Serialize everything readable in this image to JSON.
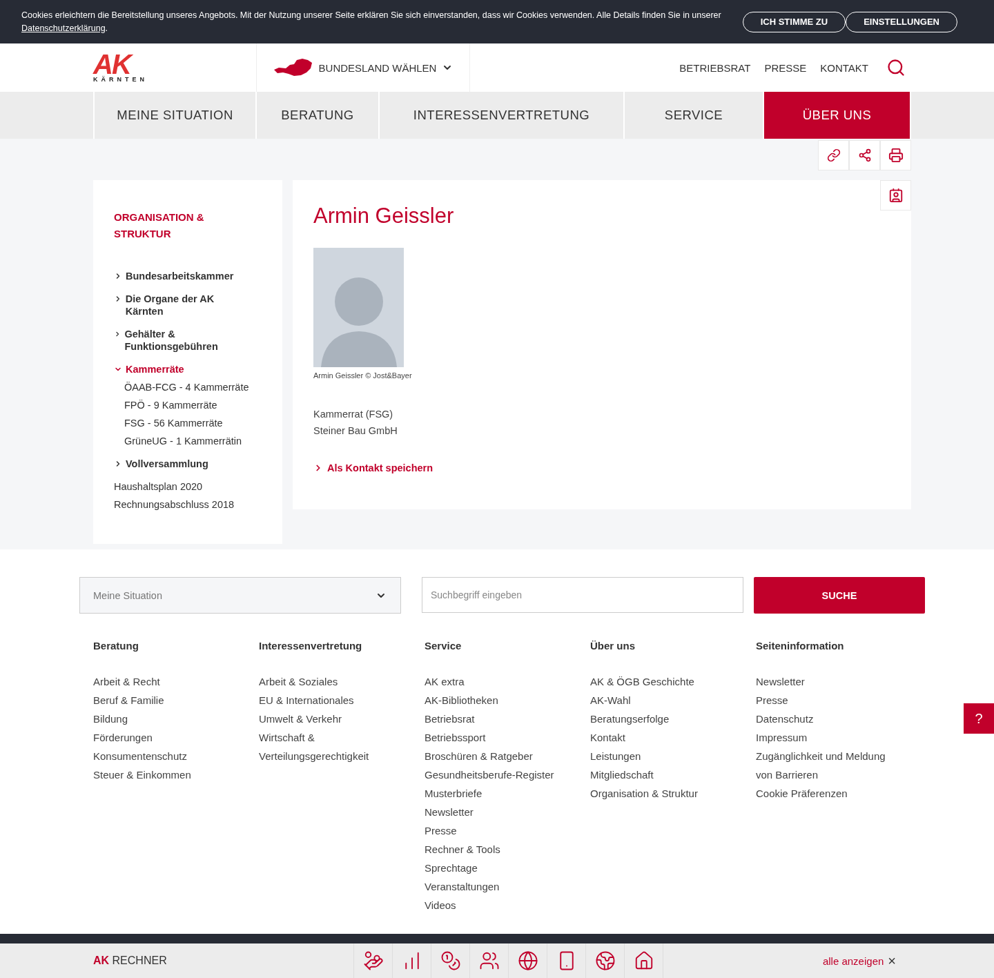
{
  "cookie_banner": {
    "text": "Cookies erleichtern die Bereitstellung unseres Angebots. Mit der Nutzung unserer Seite erklären Sie sich einverstanden, dass wir Cookies verwenden. Alle Details finden Sie in unserer",
    "link": "Datenschutzerklärung",
    "after_link": ".",
    "buttons": [
      "ICH STIMME ZU",
      "EINSTELLUNGEN"
    ]
  },
  "header": {
    "logo_mark": "AK",
    "logo_sub": "KÄRNTEN",
    "region_select": "BUNDESLAND WÄHLEN",
    "links": [
      "BETRIEBSRAT",
      "PRESSE",
      "KONTAKT"
    ]
  },
  "nav": [
    {
      "label": "MEINE SITUATION",
      "selected": false
    },
    {
      "label": "BERATUNG",
      "selected": false
    },
    {
      "label": "INTERESSENVERTRETUNG",
      "selected": false
    },
    {
      "label": "SERVICE",
      "selected": false
    },
    {
      "label": "ÜBER UNS",
      "selected": true
    }
  ],
  "sidebar": {
    "title": "ORGANISATION & STRUKTUR",
    "items": [
      {
        "kind": "group",
        "label": "Bundesarbeitskammer",
        "expanded": false,
        "selected": false
      },
      {
        "kind": "group",
        "label": "Die Organe der AK Kärnten",
        "expanded": false,
        "selected": false
      },
      {
        "kind": "group",
        "label": "Gehälter & Funktionsgebühren",
        "expanded": false,
        "selected": false
      },
      {
        "kind": "group",
        "label": "Kammerräte",
        "expanded": true,
        "selected": true,
        "children": [
          {
            "label": "ÖAAB-FCG - 4 Kammerräte"
          },
          {
            "label": "FPÖ - 9 Kammerräte"
          },
          {
            "label": "FSG - 56 Kammerräte"
          },
          {
            "label": "GrüneUG - 1 Kammerrätin"
          }
        ]
      },
      {
        "kind": "group",
        "label": "Vollversammlung",
        "expanded": false,
        "selected": false
      },
      {
        "kind": "link",
        "label": "Haushaltsplan 2020"
      },
      {
        "kind": "link",
        "label": "Rechnungsabschluss 2018"
      }
    ]
  },
  "person": {
    "name": "Armin Geissler",
    "caption": "Armin Geissler © Jost&Bayer",
    "details": [
      "Kammerrat (FSG)",
      "Steiner Bau GmbH"
    ],
    "contact_link": "Als Kontakt speichern"
  },
  "footer": {
    "situation_select": "Meine Situation",
    "search": {
      "placeholder": "Suchbegriff eingeben"
    },
    "search_button": "SUCHE",
    "columns": [
      {
        "heading": "Beratung",
        "links": [
          "Arbeit & Recht",
          "Beruf & Familie",
          "Bildung",
          "Förderungen",
          "Konsumentenschutz",
          "Steuer & Einkommen"
        ]
      },
      {
        "heading": "Interessenvertretung",
        "links": [
          "Arbeit & Soziales",
          "EU & Internationales",
          "Umwelt & Verkehr",
          "Wirtschaft & Verteilungsgerechtigkeit"
        ]
      },
      {
        "heading": "Service",
        "links": [
          "AK extra",
          "AK-Bibliotheken",
          "Betriebsrat",
          "Betriebssport",
          "Broschüren & Ratgeber",
          "Gesundheitsberufe-Register",
          "Musterbriefe",
          "Newsletter",
          "Presse",
          "Rechner & Tools",
          "Sprechtage",
          "Veranstaltungen",
          "Videos"
        ]
      },
      {
        "heading": "Über uns",
        "links": [
          "AK & ÖGB Geschichte",
          "AK-Wahl",
          "Beratungserfolge",
          "Kontakt",
          "Leistungen",
          "Mitgliedschaft",
          "Organisation & Struktur"
        ]
      },
      {
        "heading": "Seiteninformation",
        "links": [
          "Newsletter",
          "Presse",
          "Datenschutz",
          "Impressum",
          "Zugänglichkeit und Meldung von Barrieren",
          "Cookie Präferenzen"
        ]
      }
    ]
  },
  "help_button": "?",
  "calculator_bar": {
    "brand": "AK",
    "title": "RECHNER",
    "show_all": "alle anzeigen",
    "close": "×"
  }
}
